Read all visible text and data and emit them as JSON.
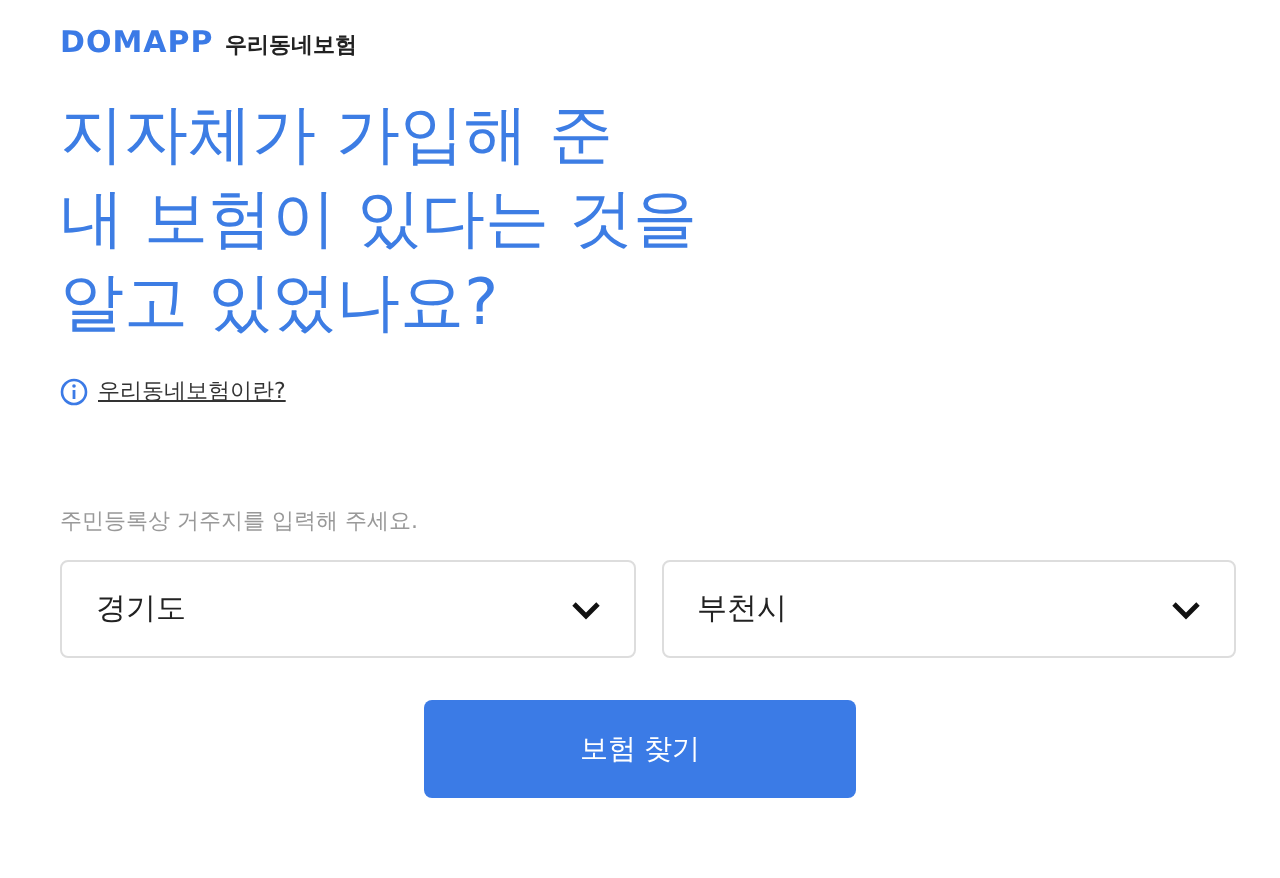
{
  "header": {
    "brand": "DOMAPP",
    "service": "우리동네보험"
  },
  "headline": [
    "지자체가 가입해 준",
    "내 보험이 있다는 것을",
    "알고 있었나요?"
  ],
  "info_link": "우리동네보험이란?",
  "address_hint": "주민등록상 거주지를 입력해 주세요.",
  "selects": [
    {
      "value": "경기도"
    },
    {
      "value": "부천시"
    }
  ],
  "submit_button": "보험 찾기"
}
